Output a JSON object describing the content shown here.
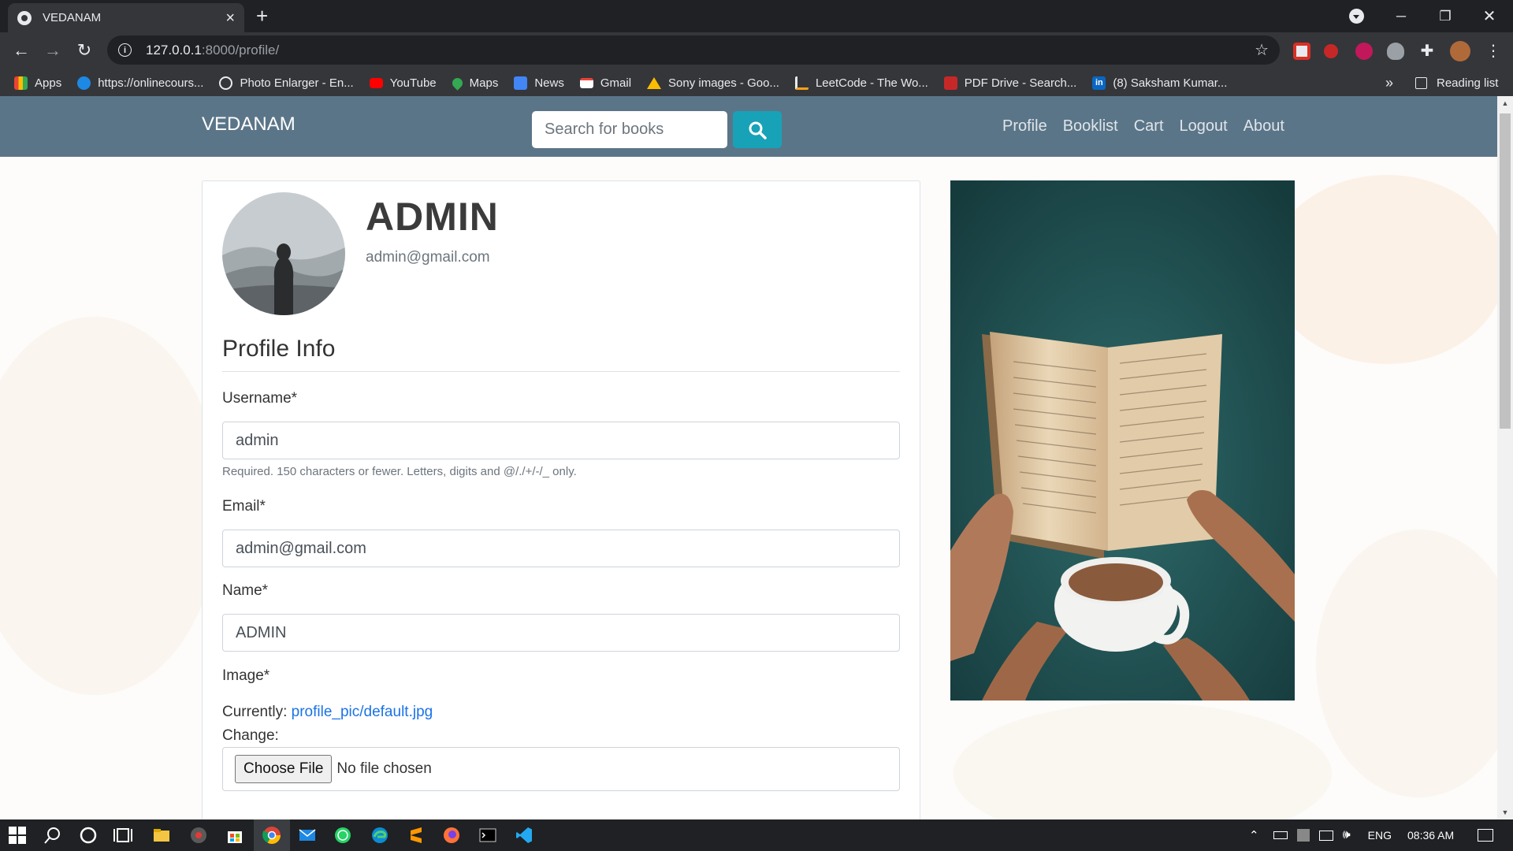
{
  "browser": {
    "tab_title": "VEDANAM",
    "url_host": "127.0.0.1",
    "url_rest": ":8000/profile/",
    "bookmarks": [
      {
        "label": "Apps",
        "icon": "apps-grid-icon",
        "color": "#ea4335"
      },
      {
        "label": "https://onlinecours...",
        "icon": "edge-icon",
        "color": "#1e88e5"
      },
      {
        "label": "Photo Enlarger - En...",
        "icon": "magnifier-icon",
        "color": "#e8eaed"
      },
      {
        "label": "YouTube",
        "icon": "youtube-icon",
        "color": "#ff0000"
      },
      {
        "label": "Maps",
        "icon": "maps-pin-icon",
        "color": "#34a853"
      },
      {
        "label": "News",
        "icon": "news-icon",
        "color": "#4285f4"
      },
      {
        "label": "Gmail",
        "icon": "gmail-icon",
        "color": "#ea4335"
      },
      {
        "label": "Sony images - Goo...",
        "icon": "drive-icon",
        "color": "#fbbc04"
      },
      {
        "label": "LeetCode - The Wo...",
        "icon": "leetcode-icon",
        "color": "#e8eaed"
      },
      {
        "label": "PDF Drive - Search...",
        "icon": "pdf-drive-icon",
        "color": "#c62828"
      },
      {
        "label": "(8) Saksham Kumar...",
        "icon": "linkedin-icon",
        "color": "#0a66c2"
      }
    ],
    "reading_list": "Reading list",
    "more": "»"
  },
  "site": {
    "brand": "VEDANAM",
    "search_placeholder": "Search for books",
    "nav": [
      "Profile",
      "Booklist",
      "Cart",
      "Logout",
      "About"
    ],
    "accent": "#17a2b8",
    "navbar_color": "#5b7588"
  },
  "profile": {
    "display_name": "ADMIN",
    "email": "admin@gmail.com",
    "section_title": "Profile Info",
    "username_label": "Username*",
    "username_value": "admin",
    "username_help": "Required. 150 characters or fewer. Letters, digits and @/./+/-/_ only.",
    "email_label": "Email*",
    "email_value": "admin@gmail.com",
    "name_label": "Name*",
    "name_value": "ADMIN",
    "image_label": "Image*",
    "currently_label": "Currently:",
    "current_file": "profile_pic/default.jpg",
    "change_label": "Change:",
    "choose_file": "Choose File",
    "no_file": "No file chosen"
  },
  "taskbar": {
    "language": "ENG",
    "time": "08:36 AM"
  }
}
